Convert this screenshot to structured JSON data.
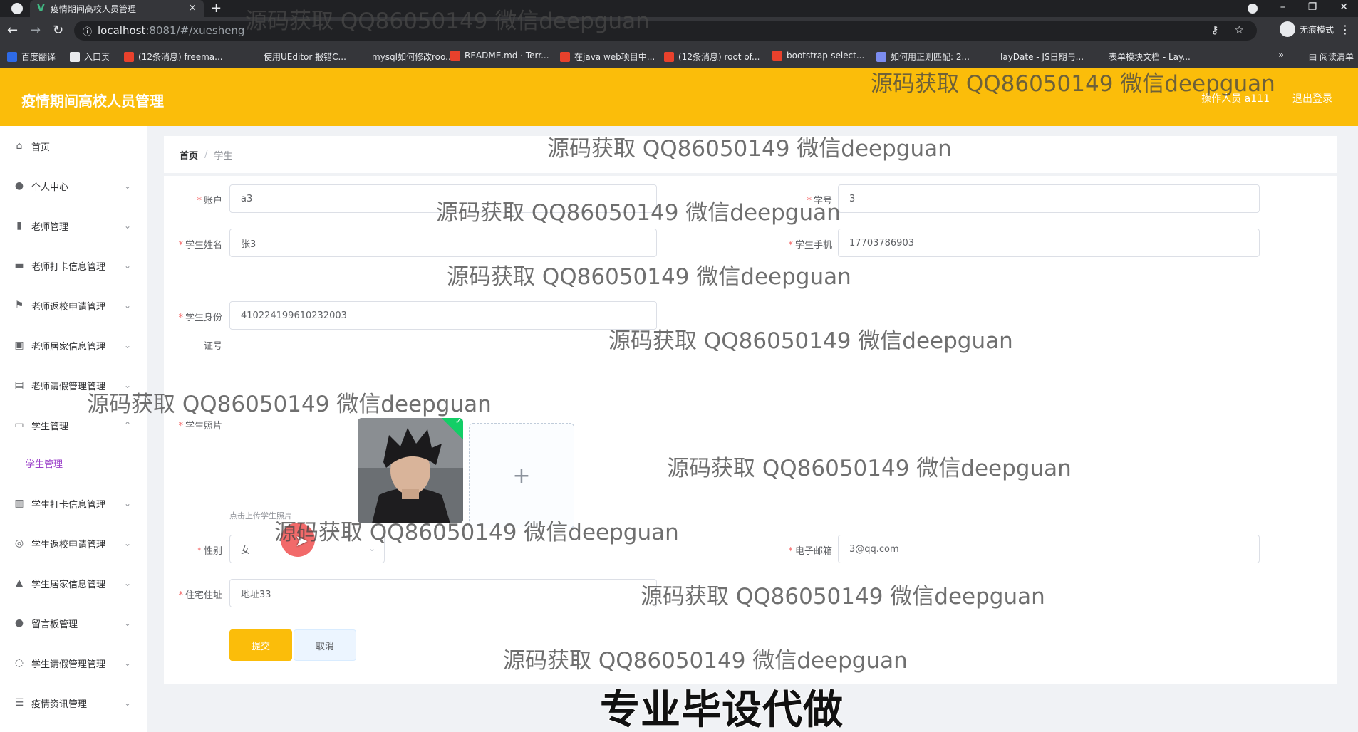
{
  "browser": {
    "tab_title": "疫情期间高校人员管理",
    "tab_close": "×",
    "new_tab": "+",
    "url_host": "localhost",
    "url_rest": ":8081/#/xuesheng",
    "incognito_label": "无痕模式",
    "bookmarks": [
      {
        "label": "百度翻译",
        "color": "#2e6ae6"
      },
      {
        "label": "入口页",
        "color": "#e8eaed"
      },
      {
        "label": "(12条消息) freema...",
        "color": "#e8412c"
      },
      {
        "label": "使用UEditor 报错C...",
        "color": "#35363a"
      },
      {
        "label": "mysql如何修改roo...",
        "color": "#35363a"
      },
      {
        "label": "README.md · Terr...",
        "color": "#e8412c"
      },
      {
        "label": "在java web项目中...",
        "color": "#e8412c"
      },
      {
        "label": "(12条消息) root of...",
        "color": "#e8412c"
      },
      {
        "label": "bootstrap-select...",
        "color": "#e8412c"
      },
      {
        "label": "如何用正则匹配: 2...",
        "color": "#7b8cf0"
      },
      {
        "label": "layDate - JS日期与...",
        "color": "#35363a"
      },
      {
        "label": "表单模块文档 - Lay...",
        "color": "#35363a"
      }
    ],
    "bookmarks_more": "»",
    "reading_list": "阅读清单"
  },
  "header": {
    "title": "疫情期间高校人员管理",
    "user": "操作人员 a111",
    "logout": "退出登录"
  },
  "sidebar": {
    "items": [
      {
        "label": "首页",
        "icon": "home-icon",
        "glyph": "⌂",
        "chevron": false
      },
      {
        "label": "个人中心",
        "icon": "user-icon",
        "glyph": "●",
        "chevron": true
      },
      {
        "label": "老师管理",
        "icon": "chart-icon",
        "glyph": "▮",
        "chevron": true
      },
      {
        "label": "老师打卡信息管理",
        "icon": "briefcase-icon",
        "glyph": "▬",
        "chevron": true
      },
      {
        "label": "老师返校申请管理",
        "icon": "flag-icon",
        "glyph": "⚑",
        "chevron": true
      },
      {
        "label": "老师居家信息管理",
        "icon": "picture-icon",
        "glyph": "▣",
        "chevron": true
      },
      {
        "label": "老师请假管理管理",
        "icon": "clipboard-icon",
        "glyph": "▤",
        "chevron": true
      },
      {
        "label": "学生管理",
        "icon": "monitor-icon",
        "glyph": "▭",
        "chevron": true,
        "expanded": true
      },
      {
        "label": "学生打卡信息管理",
        "icon": "books-icon",
        "glyph": "▥",
        "chevron": true
      },
      {
        "label": "学生返校申请管理",
        "icon": "target-icon",
        "glyph": "◎",
        "chevron": true
      },
      {
        "label": "学生居家信息管理",
        "icon": "thumb-icon",
        "glyph": "▲",
        "chevron": true
      },
      {
        "label": "留言板管理",
        "icon": "person-icon",
        "glyph": "●",
        "chevron": true
      },
      {
        "label": "学生请假管理管理",
        "icon": "compass-icon",
        "glyph": "◌",
        "chevron": true
      },
      {
        "label": "疫情资讯管理",
        "icon": "list-icon",
        "glyph": "☰",
        "chevron": true
      }
    ],
    "submenu": {
      "label": "学生管理"
    },
    "chevron_down": "⌄",
    "chevron_up": "⌃"
  },
  "breadcrumb": {
    "home": "首页",
    "sep": "/",
    "current": "学生"
  },
  "form": {
    "account": {
      "label": "账户",
      "value": "a3"
    },
    "student_no": {
      "label": "学号",
      "value": "3"
    },
    "name": {
      "label": "学生姓名",
      "value": "张3"
    },
    "phone": {
      "label": "学生手机",
      "value": "17703786903"
    },
    "id_card": {
      "label_line1": "学生身份",
      "label_line2": "证号",
      "value": "410224199610232003"
    },
    "photo": {
      "label": "学生照片",
      "tip": "点击上传学生照片",
      "upload_plus": "+",
      "check": "✓"
    },
    "gender": {
      "label": "性别",
      "value": "女",
      "arrow": "⌄"
    },
    "email": {
      "label": "电子邮箱",
      "value": "3@qq.com"
    },
    "address": {
      "label": "住宅住址",
      "value": "地址33"
    },
    "required_mark": "*",
    "submit": "提交",
    "cancel": "取消"
  },
  "overlay": {
    "watermark": "源码获取 QQ86050149 微信deepguan",
    "banner": "专业毕设代做"
  },
  "colors": {
    "header_bg": "#fbbd0a",
    "submenu_active": "#9b40c9",
    "required": "#f56c6c"
  }
}
